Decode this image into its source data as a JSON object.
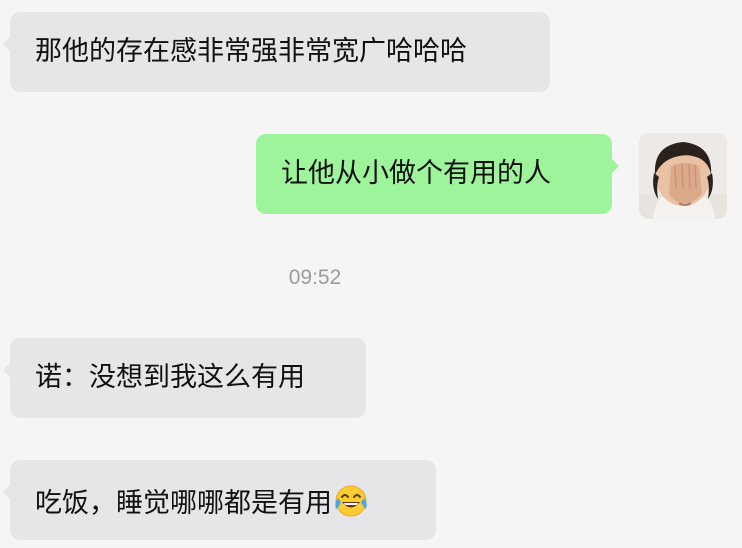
{
  "messages": [
    {
      "side": "left",
      "text": "那他的存在感非常强非常宽广哈哈哈"
    },
    {
      "side": "right",
      "text": "让他从小做个有用的人"
    },
    {
      "side": "left",
      "text": "诺：没想到我这么有用"
    },
    {
      "side": "left",
      "text": "吃饭，睡觉哪哪都是有用",
      "emoji": "laughing-tears-emoji"
    }
  ],
  "timestamp": "09:52",
  "avatar": {
    "icon": "child-face-palm-photo"
  },
  "colors": {
    "background": "#f5f5f5",
    "bubble_left": "#e6e6e8",
    "bubble_right": "#9df49a",
    "timestamp_text": "#9b9b9b"
  }
}
